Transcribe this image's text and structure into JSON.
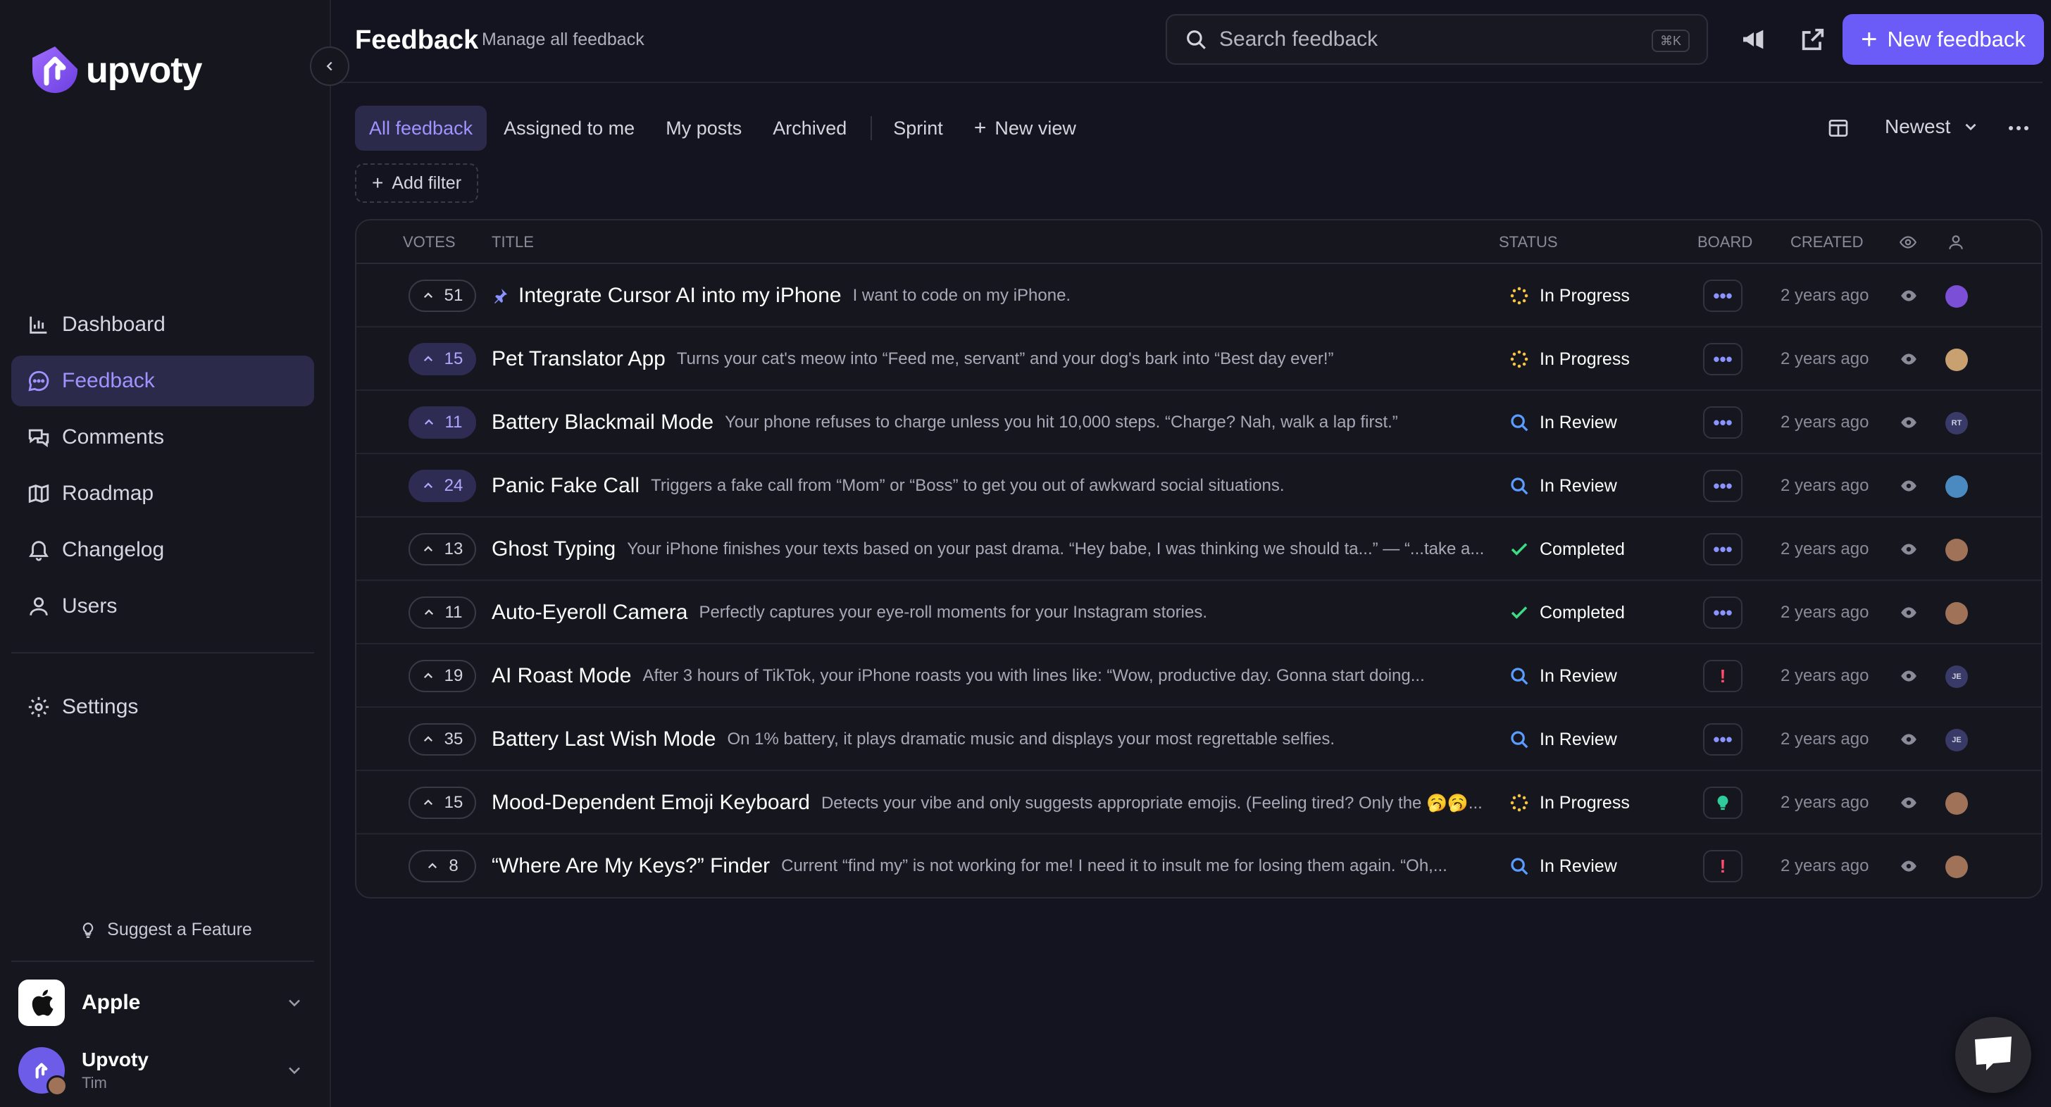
{
  "sidebar": {
    "logo_text": "upvoty",
    "items": [
      {
        "label": "Dashboard",
        "icon": "chart-icon"
      },
      {
        "label": "Feedback",
        "icon": "chat-bubble-icon",
        "active": true
      },
      {
        "label": "Comments",
        "icon": "comments-icon"
      },
      {
        "label": "Roadmap",
        "icon": "map-icon"
      },
      {
        "label": "Changelog",
        "icon": "bell-icon"
      },
      {
        "label": "Users",
        "icon": "user-icon"
      }
    ],
    "settings_label": "Settings",
    "suggest_label": "Suggest a Feature",
    "workspace_name": "Apple",
    "user_name": "Upvoty",
    "user_sub": "Tim"
  },
  "header": {
    "title": "Feedback",
    "subtitle": "Manage all feedback",
    "search_placeholder": "Search feedback",
    "search_shortcut": "⌘K",
    "new_button_label": "New feedback"
  },
  "tabs": [
    {
      "label": "All feedback",
      "active": true
    },
    {
      "label": "Assigned to me"
    },
    {
      "label": "My posts"
    },
    {
      "label": "Archived"
    },
    {
      "label": "Sprint"
    },
    {
      "label": "New view"
    }
  ],
  "sort_label": "Newest",
  "add_filter_label": "Add filter",
  "table": {
    "columns": {
      "votes": "VOTES",
      "title": "TITLE",
      "status": "STATUS",
      "board": "BOARD",
      "created": "CREATED"
    },
    "rows": [
      {
        "votes": "51",
        "voted": false,
        "pinned": true,
        "title": "Integrate Cursor AI into my iPhone",
        "desc": "I want to code on my iPhone.",
        "status": "In Progress",
        "status_icon": "progress",
        "board": "dots",
        "created": "2 years ago",
        "avatar_color": "#7b4fd6",
        "avatar_text": ""
      },
      {
        "votes": "15",
        "voted": true,
        "pinned": false,
        "title": "Pet Translator App",
        "desc": "Turns your cat's meow into “Feed me, servant” and your dog's bark into “Best day ever!”",
        "status": "In Progress",
        "status_icon": "progress",
        "board": "dots",
        "created": "2 years ago",
        "avatar_color": "#c9a070",
        "avatar_text": ""
      },
      {
        "votes": "11",
        "voted": true,
        "pinned": false,
        "title": "Battery Blackmail Mode",
        "desc": "Your phone refuses to charge unless you hit 10,000 steps. “Charge? Nah, walk a lap first.”",
        "status": "In Review",
        "status_icon": "review",
        "board": "dots",
        "created": "2 years ago",
        "avatar_color": "#3a3a68",
        "avatar_text": "RT"
      },
      {
        "votes": "24",
        "voted": true,
        "pinned": false,
        "title": "Panic Fake Call",
        "desc": "Triggers a fake call from “Mom” or “Boss” to get you out of awkward social situations.",
        "status": "In Review",
        "status_icon": "review",
        "board": "dots",
        "created": "2 years ago",
        "avatar_color": "#4a8ac0",
        "avatar_text": ""
      },
      {
        "votes": "13",
        "voted": false,
        "pinned": false,
        "title": "Ghost Typing",
        "desc": "Your iPhone finishes your texts based on your past drama. “Hey babe, I was thinking we should ta...” — “...take a...",
        "status": "Completed",
        "status_icon": "completed",
        "board": "dots",
        "created": "2 years ago",
        "avatar_color": "#a07258",
        "avatar_text": ""
      },
      {
        "votes": "11",
        "voted": false,
        "pinned": false,
        "title": "Auto-Eyeroll Camera",
        "desc": "Perfectly captures your eye-roll moments for your Instagram stories.",
        "status": "Completed",
        "status_icon": "completed",
        "board": "dots",
        "created": "2 years ago",
        "avatar_color": "#a07258",
        "avatar_text": ""
      },
      {
        "votes": "19",
        "voted": false,
        "pinned": false,
        "title": "AI Roast Mode",
        "desc": "After 3 hours of TikTok, your iPhone roasts you with lines like: “Wow, productive day. Gonna start doing...",
        "status": "In Review",
        "status_icon": "review",
        "board": "warn",
        "created": "2 years ago",
        "avatar_color": "#3a3a68",
        "avatar_text": "JE"
      },
      {
        "votes": "35",
        "voted": false,
        "pinned": false,
        "title": "Battery Last Wish Mode",
        "desc": "On 1% battery, it plays dramatic music and displays your most regrettable selfies.",
        "status": "In Review",
        "status_icon": "review",
        "board": "dots",
        "created": "2 years ago",
        "avatar_color": "#3a3a68",
        "avatar_text": "JE"
      },
      {
        "votes": "15",
        "voted": false,
        "pinned": false,
        "title": "Mood-Dependent Emoji Keyboard",
        "desc": "Detects your vibe and only suggests appropriate emojis. (Feeling tired? Only the 🥱🥱...",
        "status": "In Progress",
        "status_icon": "progress",
        "board": "hint",
        "created": "2 years ago",
        "avatar_color": "#a07258",
        "avatar_text": ""
      },
      {
        "votes": "8",
        "voted": false,
        "pinned": false,
        "title": "“Where Are My Keys?” Finder",
        "desc": "Current “find my” is not working for me! I need it to insult me for losing them again. “Oh,...",
        "status": "In Review",
        "status_icon": "review",
        "board": "warn",
        "created": "2 years ago",
        "avatar_color": "#a07258",
        "avatar_text": ""
      }
    ]
  },
  "colors": {
    "accent": "#6b5bf7",
    "active_bg": "#2c2a4a",
    "active_text": "#9f94ff",
    "completed": "#3ddc84",
    "review": "#5b9cff",
    "progress": "#f5c542"
  }
}
